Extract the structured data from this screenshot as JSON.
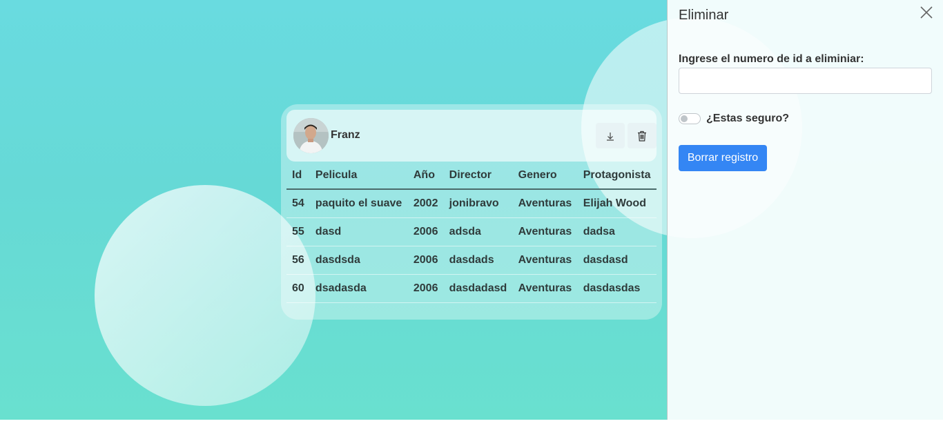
{
  "user": {
    "name": "Franz"
  },
  "table": {
    "columns": [
      "Id",
      "Pelicula",
      "Año",
      "Director",
      "Genero",
      "Protagonista"
    ],
    "rows": [
      [
        "54",
        "paquito el suave",
        "2002",
        "jonibravo",
        "Aventuras",
        "Elijah Wood"
      ],
      [
        "55",
        "dasd",
        "2006",
        "adsda",
        "Aventuras",
        "dadsa"
      ],
      [
        "56",
        "dasdsda",
        "2006",
        "dasdads",
        "Aventuras",
        "dasdasd"
      ],
      [
        "60",
        "dsadasda",
        "2006",
        "dasdadasd",
        "Aventuras",
        "dasdasdas"
      ]
    ]
  },
  "icons": {
    "download": "download-icon",
    "delete": "trash-icon",
    "close": "close-icon"
  },
  "panel": {
    "title": "Eliminar",
    "id_label": "Ingrese el numero de id a eliminiar:",
    "id_value": "",
    "confirm_label": "¿Estas seguro?",
    "confirm_checked": false,
    "submit_label": "Borrar registro"
  },
  "colors": {
    "accent": "#3486f4",
    "background_top": "#69dbe0",
    "background_bottom": "#69e0cf"
  }
}
